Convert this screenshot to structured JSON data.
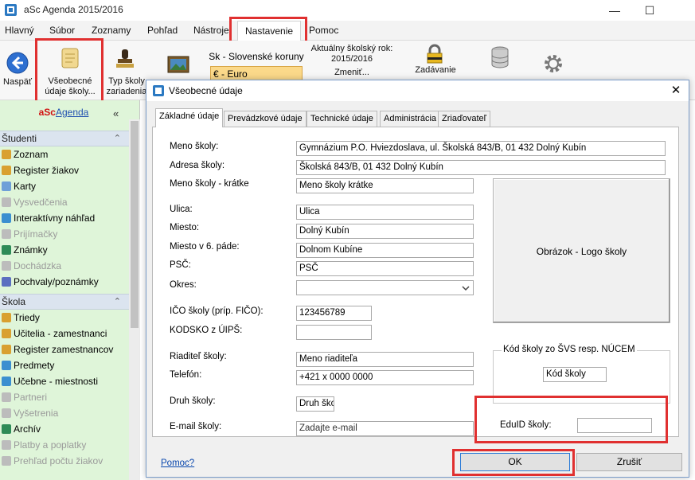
{
  "window": {
    "title": "aSc Agenda 2015/2016",
    "minimize": "—",
    "maximize": "☐"
  },
  "menu": [
    "Hlavný",
    "Súbor",
    "Zoznamy",
    "Pohľad",
    "Nástroje",
    "Nastavenie",
    "Pomoc"
  ],
  "ribbon": {
    "back": "Naspäť",
    "general": "Všeobecné\núdaje školy...",
    "school_type": "Typ školy\nzariadenia",
    "currency_group": "Sk - Slovenské koruny",
    "currency_selected": "€ - Euro",
    "year_label": "Aktuálny školský rok:",
    "year_value": "2015/2016",
    "year_change": "Zmeniť...",
    "entry": "Zadávanie"
  },
  "sidebar": {
    "brand_prefix": "aSc",
    "brand_suffix": "Agenda",
    "collapse": "«",
    "sections": [
      {
        "title": "Študenti",
        "items": [
          {
            "label": "Zoznam",
            "disabled": false,
            "color": "#d9a030"
          },
          {
            "label": "Register žiakov",
            "disabled": false,
            "color": "#d9a030"
          },
          {
            "label": "Karty",
            "disabled": false,
            "color": "#6fa0d8"
          },
          {
            "label": "Vysvedčenia",
            "disabled": true,
            "color": "#bcbcbc"
          },
          {
            "label": "Interaktívny náhľad",
            "disabled": false,
            "color": "#3b8fd0"
          },
          {
            "label": "Prijímačky",
            "disabled": true,
            "color": "#bcbcbc"
          },
          {
            "label": "Známky",
            "disabled": false,
            "color": "#2e8b57"
          },
          {
            "label": "Dochádzka",
            "disabled": true,
            "color": "#bcbcbc"
          },
          {
            "label": "Pochvaly/poznámky",
            "disabled": false,
            "color": "#5b6fc0"
          }
        ]
      },
      {
        "title": "Škola",
        "items": [
          {
            "label": "Triedy",
            "disabled": false,
            "color": "#d9a030"
          },
          {
            "label": "Učitelia - zamestnanci",
            "disabled": false,
            "color": "#d9a030"
          },
          {
            "label": "Register zamestnancov",
            "disabled": false,
            "color": "#d9a030"
          },
          {
            "label": "Predmety",
            "disabled": false,
            "color": "#3b8fd0"
          },
          {
            "label": "Učebne - miestnosti",
            "disabled": false,
            "color": "#3b8fd0"
          },
          {
            "label": "Partneri",
            "disabled": true,
            "color": "#bcbcbc"
          },
          {
            "label": "Vyšetrenia",
            "disabled": true,
            "color": "#bcbcbc"
          },
          {
            "label": "Archív",
            "disabled": false,
            "color": "#2e8b57"
          },
          {
            "label": "Platby a poplatky",
            "disabled": true,
            "color": "#bcbcbc"
          },
          {
            "label": "Prehľad počtu žiakov",
            "disabled": true,
            "color": "#bcbcbc"
          }
        ]
      }
    ]
  },
  "dialog": {
    "title": "Všeobecné údaje",
    "close": "✕",
    "tabs": [
      "Základné údaje",
      "Prevádzkové údaje",
      "Technické údaje",
      "Administrácia",
      "Zriaďovateľ"
    ],
    "fields": {
      "name_label": "Meno školy:",
      "name_value": "Gymnázium P.O. Hviezdoslava, ul. Školská 843/B, 01 432 Dolný Kubín",
      "address_label": "Adresa školy:",
      "address_value": "Školská 843/B, 01 432 Dolný Kubín",
      "short_label": "Meno školy - krátke",
      "short_value": "Meno školy krátke",
      "street_label": "Ulica:",
      "street_value": "Ulica",
      "city_label": "Miesto:",
      "city_value": "Dolný Kubín",
      "city6_label": "Miesto v 6. páde:",
      "city6_value": "Dolnom Kubíne",
      "psc_label": "PSČ:",
      "psc_value": "PSČ",
      "district_label": "Okres:",
      "district_value": "",
      "ico_label": "IČO školy (príp. FIČO):",
      "ico_value": "123456789",
      "kodsko_label": "KODSKO z ÚIPŠ:",
      "kodsko_value": "",
      "director_label": "Riaditeľ školy:",
      "director_value": "Meno riaditeľa",
      "phone_label": "Telefón:",
      "phone_value": "+421 x 0000 0000",
      "type_label": "Druh školy:",
      "type_value": "Druh škola",
      "email_label": "E-mail školy:",
      "email_placeholder": "Zadajte e-mail",
      "logo_label": "Obrázok - Logo školy",
      "kod_group": "Kód školy zo ŠVS resp. NÚCEM",
      "kod_value": "Kód školy",
      "eduid_label": "EduID školy:",
      "eduid_value": ""
    },
    "help": "Pomoc?",
    "ok": "OK",
    "cancel": "Zrušiť"
  }
}
